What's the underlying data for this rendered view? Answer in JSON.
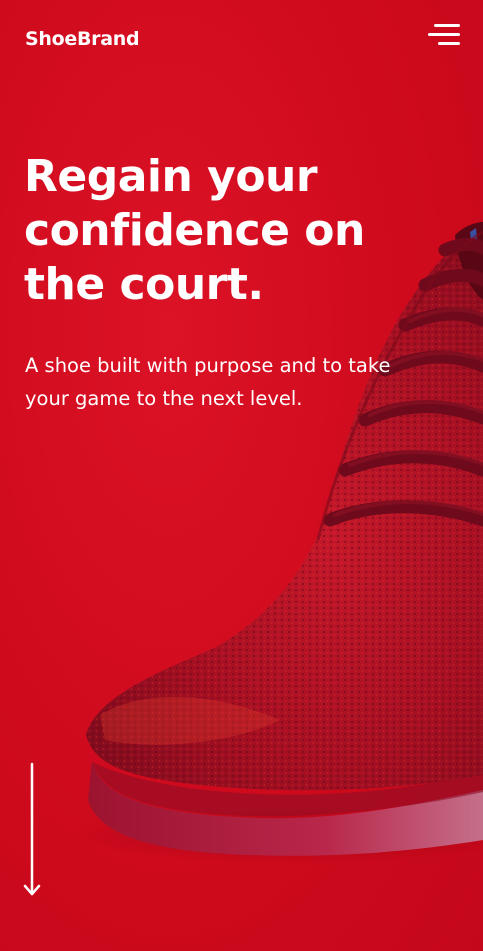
{
  "header": {
    "brand": "ShoeBrand",
    "menu_icon": "hamburger-menu-icon"
  },
  "hero": {
    "headline_lines": [
      "Regain your",
      "confidence on",
      "the court."
    ],
    "subtext_lines": [
      "A shoe built with purpose and to take",
      "your game to the next level."
    ],
    "image": "red-knit-sneaker-image",
    "scroll_icon": "arrow-down-icon"
  },
  "colors": {
    "background": "#d30a1f",
    "shoe_knit": "#a50f22",
    "shoe_laces": "#6e0a1c",
    "sole": "#b31c3a",
    "text": "#ffffff"
  }
}
